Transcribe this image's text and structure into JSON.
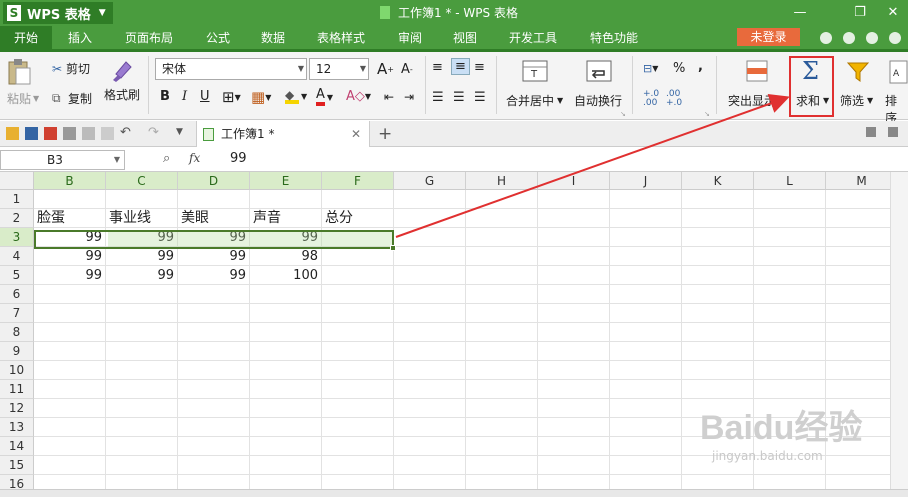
{
  "titlebar": {
    "app_name": "WPS 表格",
    "logo_letter": "S",
    "document_title": "工作簿1 * - WPS 表格"
  },
  "menu": {
    "items": [
      "开始",
      "插入",
      "页面布局",
      "公式",
      "数据",
      "表格样式",
      "审阅",
      "视图",
      "开发工具",
      "特色功能"
    ],
    "active": "开始",
    "login_label": "未登录"
  },
  "ribbon": {
    "paste_label": "粘贴",
    "cut_label": "剪切",
    "copy_label": "复制",
    "format_painter_label": "格式刷",
    "font_name": "宋体",
    "font_size": "12",
    "bold": "B",
    "italic": "I",
    "underline": "U",
    "merge_center_label": "合并居中",
    "wrap_text_label": "自动换行",
    "highlight_label": "突出显示",
    "sum_label": "求和",
    "filter_label": "筛选",
    "sort_label": "排序",
    "percent_symbol": "%",
    "grow_font": "A",
    "shrink_font": "A",
    "font_color_letter": "A"
  },
  "doc_tabs": {
    "active_tab": "工作簿1 *",
    "add_tab": "+"
  },
  "formula_bar": {
    "name_box": "B3",
    "fx_label": "fx",
    "value": "99"
  },
  "columns": [
    "B",
    "C",
    "D",
    "E",
    "F",
    "G",
    "H",
    "I",
    "J",
    "K",
    "L",
    "M"
  ],
  "rows": [
    "1",
    "2",
    "3",
    "4",
    "5",
    "6",
    "7",
    "8",
    "9",
    "10",
    "11",
    "12",
    "13",
    "14",
    "15",
    "16"
  ],
  "table": {
    "headers": [
      "脸蛋",
      "事业线",
      "美眼",
      "声音",
      "总分"
    ],
    "data": [
      [
        "99",
        "99",
        "99",
        "99",
        ""
      ],
      [
        "99",
        "99",
        "99",
        "98",
        ""
      ],
      [
        "99",
        "99",
        "99",
        "100",
        ""
      ]
    ]
  },
  "selection": {
    "row": "3",
    "columns": [
      "B",
      "C",
      "D",
      "E",
      "F"
    ]
  },
  "watermark": {
    "brand": "Baidu经验",
    "url": "jingyan.baidu.com"
  },
  "colors": {
    "titlebar": "#4a9c3e",
    "accent_dark": "#2f7d26",
    "login_button": "#e86a3c",
    "annotation_red": "#e03030",
    "selection_border": "#4a7a2a"
  }
}
